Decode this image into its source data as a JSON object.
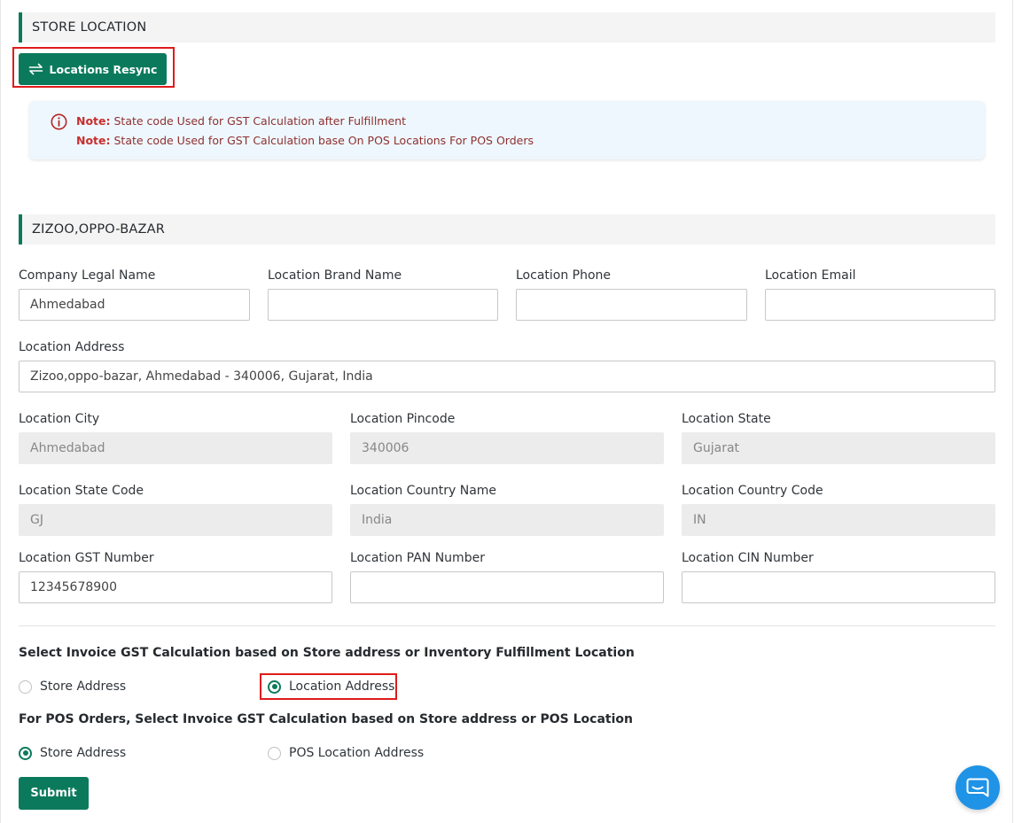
{
  "store_section": {
    "title": "STORE LOCATION",
    "resync_label": "Locations Resync"
  },
  "notes": [
    {
      "prefix": "Note:",
      "text": " State code Used for GST Calculation after Fulfillment"
    },
    {
      "prefix": "Note:",
      "text": " State code Used for GST Calculation base On POS Locations For POS Orders"
    }
  ],
  "location_section": {
    "title": "ZIZOO,OPPO-BAZAR"
  },
  "fields": {
    "company_legal_name": {
      "label": "Company Legal Name",
      "value": "Ahmedabad"
    },
    "location_brand_name": {
      "label": "Location Brand Name",
      "value": ""
    },
    "location_phone": {
      "label": "Location Phone",
      "value": ""
    },
    "location_email": {
      "label": "Location Email",
      "value": ""
    },
    "location_address": {
      "label": "Location Address",
      "value": "Zizoo,oppo-bazar, Ahmedabad - 340006, Gujarat, India"
    },
    "location_city": {
      "label": "Location City",
      "value": "Ahmedabad"
    },
    "location_pincode": {
      "label": "Location Pincode",
      "value": "340006"
    },
    "location_state": {
      "label": "Location State",
      "value": "Gujarat"
    },
    "location_state_code": {
      "label": "Location State Code",
      "value": "GJ"
    },
    "location_country_name": {
      "label": "Location Country Name",
      "value": "India"
    },
    "location_country_code": {
      "label": "Location Country Code",
      "value": "IN"
    },
    "location_gst_number": {
      "label": "Location GST Number",
      "value": "12345678900"
    },
    "location_pan_number": {
      "label": "Location PAN Number",
      "value": ""
    },
    "location_cin_number": {
      "label": "Location CIN Number",
      "value": ""
    }
  },
  "invoice_gst": {
    "question": "Select Invoice GST Calculation based on Store address or Inventory Fulfillment Location",
    "options": [
      {
        "label": "Store Address",
        "selected": false
      },
      {
        "label": "Location Address",
        "selected": true
      }
    ]
  },
  "pos_gst": {
    "question": "For POS Orders, Select Invoice GST Calculation based on Store address or POS Location",
    "options": [
      {
        "label": "Store Address",
        "selected": true
      },
      {
        "label": "POS Location Address",
        "selected": false
      }
    ]
  },
  "submit_label": "Submit",
  "icons": {
    "resync": "sync-arrows-icon",
    "note": "info-circle-icon",
    "chat": "chat-bubble-icon"
  },
  "colors": {
    "primary": "#0b7a5c",
    "highlight_border": "#e01b1b",
    "note_text": "#c82e2e",
    "note_bg": "#eef7fd",
    "chat": "#1f93e6"
  }
}
